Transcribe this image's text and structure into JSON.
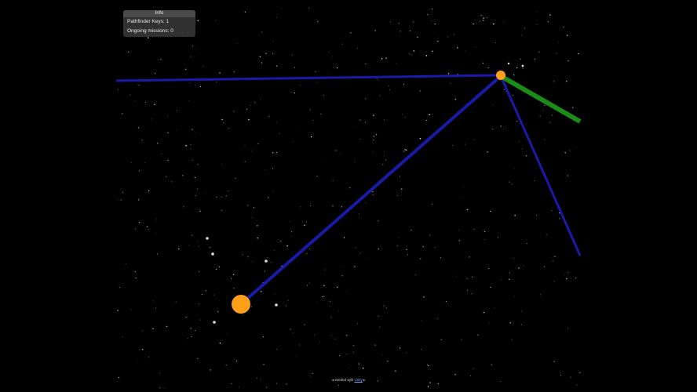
{
  "info": {
    "title": "Info",
    "pathfinder_keys_label": "Pathfinder Keys:",
    "pathfinder_keys_value": "1",
    "ongoing_missions_label": "Ongoing missions:",
    "ongoing_missions_value": "0"
  },
  "footer": {
    "prefix": "◂ seeded with",
    "link": "Unity",
    "suffix": "▸"
  },
  "colors": {
    "background": "#000000",
    "route_blue": "#1a1aa8",
    "route_green": "#1a8c1a",
    "planet_orange": "#ffa01a",
    "star_white": "#ffffff"
  }
}
